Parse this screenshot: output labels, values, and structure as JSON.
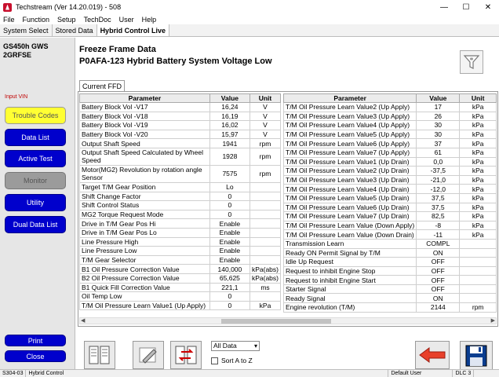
{
  "window": {
    "title": "Techstream (Ver 14.20.019) - 508",
    "controls": [
      "—",
      "☐",
      "✕"
    ]
  },
  "menu": [
    "File",
    "Function",
    "Setup",
    "TechDoc",
    "User",
    "Help"
  ],
  "tabs": [
    "System Select",
    "Stored Data",
    "Hybrid Control Live"
  ],
  "vehicle": {
    "model": "GS450h GWS",
    "engine": "2GRFSE"
  },
  "input_vin_label": "Input VIN",
  "sidebar": {
    "trouble_codes": "Trouble Codes",
    "data_list": "Data List",
    "active_test": "Active Test",
    "monitor": "Monitor",
    "utility": "Utility",
    "dual_data_list": "Dual Data List",
    "print": "Print",
    "close": "Close"
  },
  "header": {
    "title": "Freeze Frame Data",
    "dtc": "P0AFA-123 Hybrid Battery System Voltage Low"
  },
  "current_tab": "Current FFD",
  "columns": {
    "parameter": "Parameter",
    "value": "Value",
    "unit": "Unit"
  },
  "left_rows": [
    {
      "p": "Battery Block Vol -V17",
      "v": "16,24",
      "u": "V"
    },
    {
      "p": "Battery Block Vol -V18",
      "v": "16,19",
      "u": "V"
    },
    {
      "p": "Battery Block Vol -V19",
      "v": "16,02",
      "u": "V"
    },
    {
      "p": "Battery Block Vol -V20",
      "v": "15,97",
      "u": "V"
    },
    {
      "p": "Output Shaft Speed",
      "v": "1941",
      "u": "rpm"
    },
    {
      "p": "Output Shaft Speed Calculated by Wheel Speed",
      "v": "1928",
      "u": "rpm",
      "tall": true
    },
    {
      "p": "Motor(MG2) Revolution by rotation angle Sensor",
      "v": "7575",
      "u": "rpm",
      "tall": true
    },
    {
      "p": "Target T/M Gear Position",
      "v": "Lo",
      "u": ""
    },
    {
      "p": "Shift Change Factor",
      "v": "0",
      "u": ""
    },
    {
      "p": "Shift Control Status",
      "v": "0",
      "u": ""
    },
    {
      "p": "MG2 Torque Request Mode",
      "v": "0",
      "u": ""
    },
    {
      "p": "Drive in T/M Gear Pos Hi",
      "v": "Enable",
      "u": ""
    },
    {
      "p": "Drive in T/M Gear Pos Lo",
      "v": "Enable",
      "u": ""
    },
    {
      "p": "Line Pressure High",
      "v": "Enable",
      "u": ""
    },
    {
      "p": "Line Pressure Low",
      "v": "Enable",
      "u": ""
    },
    {
      "p": "T/M Gear Selector",
      "v": "Enable",
      "u": ""
    },
    {
      "p": "B1 Oil Pressure Correction Value",
      "v": "140,000",
      "u": "kPa(abs)"
    },
    {
      "p": "B2 Oil Pressure Correction Value",
      "v": "65,625",
      "u": "kPa(abs)"
    },
    {
      "p": "B1 Quick Fill Correction Value",
      "v": "221,1",
      "u": "ms"
    },
    {
      "p": "Oil Temp Low",
      "v": "0",
      "u": ""
    },
    {
      "p": "T/M Oil Pressure Learn Value1 (Up Apply)",
      "v": "0",
      "u": "kPa"
    }
  ],
  "right_rows": [
    {
      "p": "T/M Oil Pressure Learn Value2 (Up Apply)",
      "v": "17",
      "u": "kPa"
    },
    {
      "p": "T/M Oil Pressure Learn Value3 (Up Apply)",
      "v": "26",
      "u": "kPa"
    },
    {
      "p": "T/M Oil Pressure Learn Value4 (Up Apply)",
      "v": "30",
      "u": "kPa"
    },
    {
      "p": "T/M Oil Pressure Learn Value5 (Up Apply)",
      "v": "30",
      "u": "kPa"
    },
    {
      "p": "T/M Oil Pressure Learn Value6 (Up Apply)",
      "v": "37",
      "u": "kPa"
    },
    {
      "p": "T/M Oil Pressure Learn Value7 (Up Apply)",
      "v": "61",
      "u": "kPa"
    },
    {
      "p": "T/M Oil Pressure Learn Value1 (Up Drain)",
      "v": "0,0",
      "u": "kPa"
    },
    {
      "p": "T/M Oil Pressure Learn Value2 (Up Drain)",
      "v": "-37,5",
      "u": "kPa"
    },
    {
      "p": "T/M Oil Pressure Learn Value3 (Up Drain)",
      "v": "-21,0",
      "u": "kPa"
    },
    {
      "p": "T/M Oil Pressure Learn Value4 (Up Drain)",
      "v": "-12,0",
      "u": "kPa"
    },
    {
      "p": "T/M Oil Pressure Learn Value5 (Up Drain)",
      "v": "37,5",
      "u": "kPa"
    },
    {
      "p": "T/M Oil Pressure Learn Value6 (Up Drain)",
      "v": "37,5",
      "u": "kPa"
    },
    {
      "p": "T/M Oil Pressure Learn Value7 (Up Drain)",
      "v": "82,5",
      "u": "kPa"
    },
    {
      "p": "T/M Oil Pressure Learn Value (Down Apply)",
      "v": "-8",
      "u": "kPa"
    },
    {
      "p": "T/M Oil Pressure Learn Value (Down Drain)",
      "v": "-11",
      "u": "kPa"
    },
    {
      "p": "Transmission Learn",
      "v": "COMPL",
      "u": ""
    },
    {
      "p": "Ready ON Permit Signal by T/M",
      "v": "ON",
      "u": ""
    },
    {
      "p": "Idle Up Request",
      "v": "OFF",
      "u": ""
    },
    {
      "p": "Request to inhibit Engine Stop",
      "v": "OFF",
      "u": ""
    },
    {
      "p": "Request to inhibit Engine Start",
      "v": "OFF",
      "u": ""
    },
    {
      "p": "Starter Signal",
      "v": "OFF",
      "u": ""
    },
    {
      "p": "Ready Signal",
      "v": "ON",
      "u": ""
    },
    {
      "p": "Engine revolution (T/M)",
      "v": "2144",
      "u": "rpm"
    }
  ],
  "filter": {
    "selected": "All Data",
    "sort_label": "Sort A to Z"
  },
  "status": {
    "code": "S304-03",
    "section": "Hybrid Control",
    "user": "Default User",
    "dlc": "DLC 3"
  }
}
